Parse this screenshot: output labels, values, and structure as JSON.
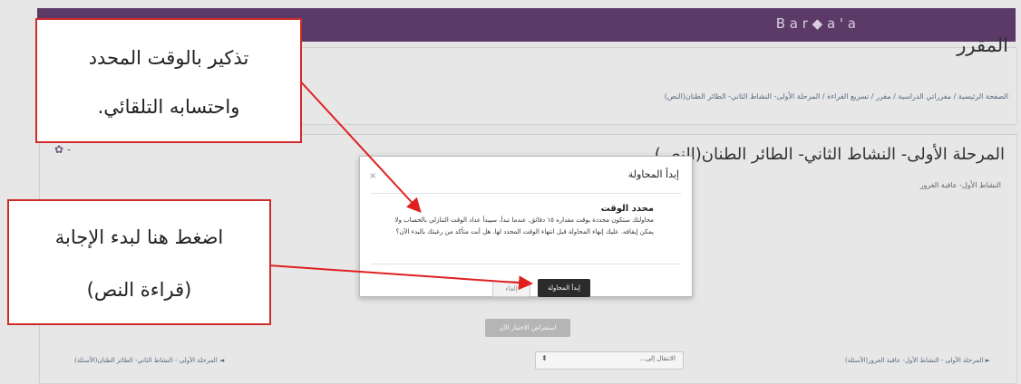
{
  "topbar": {
    "brand": "B a r ◆ a ' a"
  },
  "header": {
    "course_title": "المقرر",
    "breadcrumb": "الصفحة الرئيسية  /  مقرراتي الدراسية  /  مقرر  /  تسريع القراءة  /  المرحلة الأولى- النشاط الثاني- الطائر الطنان(النص)"
  },
  "activity": {
    "title": "المرحلة الأولى- النشاط الثاني- الطائر الطنان(النص)",
    "subtitle": "النشاط الأول- عاقبة الغرور"
  },
  "modal": {
    "title": "إبدأ المحاولة",
    "close": "×",
    "timer_heading": "محدد الوقت",
    "body": "محاولتك ستكون محددة بوقت مقداره ١٥ دقائق. عندما تبدأ، سيبدأ عداد الوقت التنازلي بالحساب ولا يمكن إيقافه. عليك إنهاء المحاولة قبل انتهاء الوقت المحدد لها. هل أنت متأكد من رغبتك بالبدء الآن؟",
    "start_button": "إبدأ المحاولة",
    "cancel_button": "إلغاء"
  },
  "preview_button": "استعراض الاختبار الآن",
  "navigation": {
    "prev": "المرحلة الأولى - النشاط الثاني- الطائر الطنان(الأسئلة) ◄",
    "next": "► المرحلة الأولى - النشاط الأول- عاقبة الغرور(الأسئلة)",
    "jump_label": "الانتقال إلى...",
    "jump_caret": "⬍"
  },
  "callouts": {
    "timer_note_line1": "تذكير بالوقت المحدد",
    "timer_note_line2": "واحتسابه التلقائي.",
    "start_note_line1": "اضغط هنا لبدء الإجابة",
    "start_note_line2": "(قراءة النص)"
  },
  "colors": {
    "topbar": "#5b3a68",
    "callout_border": "#d02b2b",
    "arrow": "#e02020",
    "start_button": "#2b2b2b"
  }
}
